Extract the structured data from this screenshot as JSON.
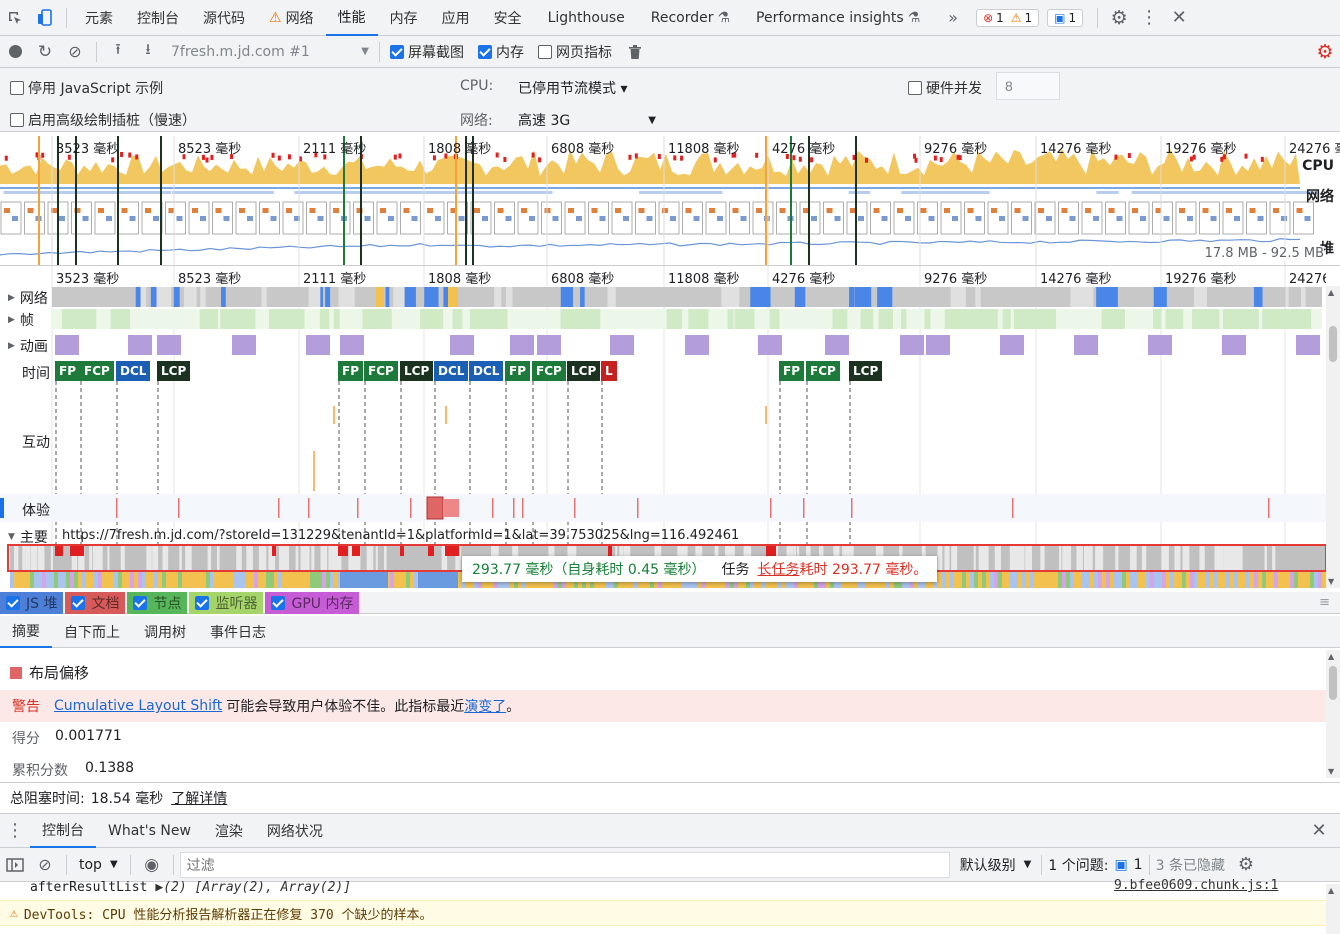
{
  "tabbar": {
    "tabs": [
      "元素",
      "控制台",
      "源代码",
      "网络",
      "性能",
      "内存",
      "应用",
      "安全",
      "Lighthouse",
      "Recorder",
      "Performance insights"
    ],
    "active_tab": "性能",
    "more": "»",
    "errors": "1",
    "warnings": "1",
    "messages": "1"
  },
  "perfbar": {
    "recording": "7fresh.m.jd.com #1",
    "screenshots_label": "屏幕截图",
    "memory_label": "内存",
    "webvitals_label": "网页指标"
  },
  "settings": {
    "disable_js_label": "停用 JavaScript 示例",
    "advanced_paint_label": "启用高级绘制插桩（慢速）",
    "cpu_label": "CPU:",
    "cpu_value": "已停用节流模式 ▾",
    "network_label": "网络:",
    "network_value": "高速 3G",
    "hardware_label": "硬件并发",
    "hardware_value": "8"
  },
  "overview": {
    "ticks": [
      "3523 毫秒",
      "8523 毫秒",
      "2111 毫秒",
      "1808 毫秒",
      "6808 毫秒",
      "11808 毫秒",
      "4276 毫秒",
      "9276 毫秒",
      "14276 毫秒",
      "19276 毫秒",
      "24276 毫秒"
    ],
    "cpu_label": "CPU",
    "net_label": "网络",
    "heap_label": "堆",
    "heap_range": "17.8 MB - 92.5 MB"
  },
  "flame": {
    "ticks": [
      "3523 毫秒",
      "8523 毫秒",
      "2111 毫秒",
      "1808 毫秒",
      "6808 毫秒",
      "11808 毫秒",
      "4276 毫秒",
      "9276 毫秒",
      "14276 毫秒",
      "19276 毫秒",
      "24276 毫秒"
    ],
    "tracks": {
      "network": "网络",
      "frames": "帧",
      "animation": "动画",
      "timings": "时间",
      "interactions": "互动",
      "experience": "体验",
      "main": "主要"
    },
    "main_url": "https://7fresh.m.jd.com/?storeId=131229&tenantId=1&platformId=1&lat=39.753025&lng=116.492461",
    "markers": [
      {
        "label": "FP",
        "color": "#1e7a3a"
      },
      {
        "label": "FCP",
        "color": "#1e7a3a"
      },
      {
        "label": "DCL",
        "color": "#1a5fb4"
      },
      {
        "label": "LCP",
        "color": "#1b3220"
      },
      {
        "label": "FP",
        "color": "#1e7a3a"
      },
      {
        "label": "FCP",
        "color": "#1e7a3a"
      },
      {
        "label": "LCP",
        "color": "#1b3220"
      },
      {
        "label": "DCL",
        "color": "#1a5fb4"
      },
      {
        "label": "DCL",
        "color": "#1a5fb4"
      },
      {
        "label": "FP",
        "color": "#1e7a3a"
      },
      {
        "label": "FCP",
        "color": "#1e7a3a"
      },
      {
        "label": "LCP",
        "color": "#1b3220"
      },
      {
        "label": "L",
        "color": "#c5221f"
      },
      {
        "label": "FP",
        "color": "#1e7a3a"
      },
      {
        "label": "FCP",
        "color": "#1e7a3a"
      },
      {
        "label": "LCP",
        "color": "#1b3220"
      }
    ],
    "tooltip": {
      "duration": "293.77 毫秒（自身耗时 0.45 毫秒）",
      "task": "任务",
      "long_task_link": "长任务",
      "long_task_text": "耗时 293.77 毫秒。"
    }
  },
  "legend": [
    {
      "label": "JS 堆",
      "color": "#4e7fd8"
    },
    {
      "label": "文档",
      "color": "#d65a5a"
    },
    {
      "label": "节点",
      "color": "#57b55a"
    },
    {
      "label": "监听器",
      "color": "#a5d46a"
    },
    {
      "label": "GPU 内存",
      "color": "#c65cd6"
    }
  ],
  "detail_tabs": [
    "摘要",
    "自下而上",
    "调用树",
    "事件日志"
  ],
  "summary": {
    "title": "布局偏移",
    "warning_label": "警告",
    "warning_link": "Cumulative Layout Shift",
    "warning_text": "可能会导致用户体验不佳。此指标最近",
    "warning_link2": "演变了",
    "warning_end": "。",
    "score_label": "得分",
    "score_value": "0.001771",
    "cumulative_label": "累积分数",
    "cumulative_value": "0.1388"
  },
  "blocking": {
    "label": "总阻塞时间:",
    "value": "18.54 毫秒",
    "link": "了解详情"
  },
  "drawer": {
    "tabs": [
      "控制台",
      "What's New",
      "渲染",
      "网络状况"
    ],
    "active": "控制台"
  },
  "console": {
    "context": "top",
    "filter_placeholder": "过滤",
    "level": "默认级别",
    "issues_label": "1 个问题:",
    "issues_count": "1",
    "hidden": "3 条已隐藏",
    "log_name": "afterResultList",
    "log_value": "▶(2) [Array(2), Array(2)]",
    "log_source": "9.bfee0609.chunk.js:1",
    "warn_text": "DevTools: CPU 性能分析报告解析器正在修复 370 个缺少的样本。"
  }
}
